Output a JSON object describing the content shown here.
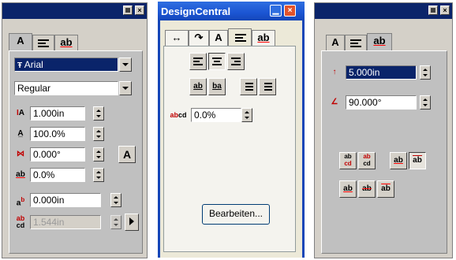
{
  "left_window": {
    "tabs": [
      "A",
      "",
      "ab"
    ],
    "font_name": "Arial",
    "font_style": "Regular",
    "height_value": "1.000in",
    "width_pct_value": "100.0%",
    "oblique_value": "0.000°",
    "char_spacing_value": "0.0%",
    "baseline_offset_value": "0.000in",
    "line_spacing_value": "1.544in",
    "a_button_label": "A"
  },
  "center_window": {
    "title": "DesignCentral",
    "tabs": [
      "",
      "",
      "A",
      "",
      "ab"
    ],
    "spacing_value": "0.0%",
    "edit_button_label": "Bearbeiten..."
  },
  "right_window": {
    "tabs": [
      "A",
      "",
      "ab"
    ],
    "arc_value": "5.000in",
    "angle_value": "90.000°"
  },
  "colors": {
    "classic_title": "#0a246a",
    "xp_title": "#1b55d3",
    "xp_close": "#e2532c",
    "selection": "#0a246a"
  }
}
